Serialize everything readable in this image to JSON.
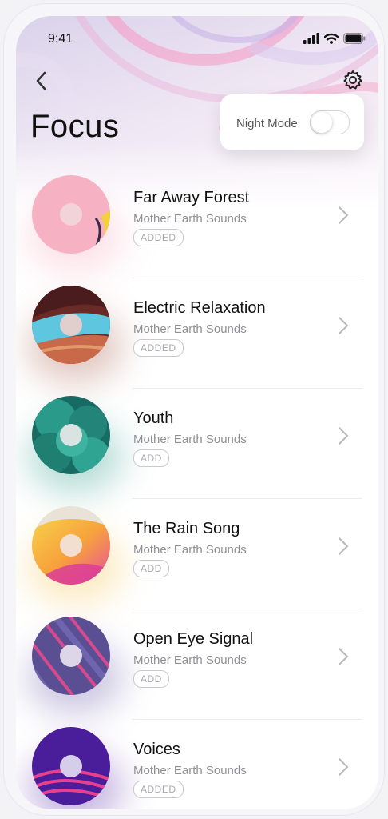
{
  "status": {
    "time": "9:41"
  },
  "page": {
    "title": "Focus"
  },
  "night_mode": {
    "label": "Night Mode",
    "enabled": false
  },
  "tracks": [
    {
      "title": "Far Away Forest",
      "artist": "Mother Earth Sounds",
      "status": "ADDED"
    },
    {
      "title": "Electric Relaxation",
      "artist": "Mother Earth Sounds",
      "status": "ADDED"
    },
    {
      "title": "Youth",
      "artist": "Mother Earth Sounds",
      "status": "ADD"
    },
    {
      "title": "The Rain Song",
      "artist": "Mother Earth Sounds",
      "status": "ADD"
    },
    {
      "title": "Open Eye Signal",
      "artist": "Mother Earth Sounds",
      "status": "ADD"
    },
    {
      "title": "Voices",
      "artist": "Mother Earth Sounds",
      "status": "ADDED"
    }
  ],
  "icons": {
    "back": "chevron-left-icon",
    "settings": "gear-icon",
    "row_arrow": "chevron-right-icon",
    "signal": "cellular-signal-icon",
    "wifi": "wifi-icon",
    "battery": "battery-icon"
  },
  "colors": {
    "accent_pink": "#f3a7c9",
    "accent_lavender": "#cbb7e4",
    "text_primary": "#111111",
    "text_secondary": "#8f8f95"
  }
}
